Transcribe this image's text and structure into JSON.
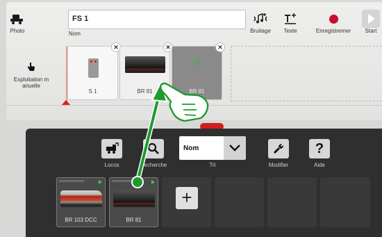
{
  "top": {
    "photo_label": "Photo",
    "name_value": "FS 1",
    "name_label": "Nom",
    "sound_label": "Bruitage",
    "text_label": "Texte",
    "record_label": "Enregistremer",
    "start_label": "Start",
    "exploit_label": "Exploitation m anuelle"
  },
  "steps": [
    {
      "label": "S 1"
    },
    {
      "label": "BR 81"
    },
    {
      "label": "BR 81",
      "value": "0"
    }
  ],
  "library": {
    "locos_label": "Locos",
    "search_label": "Recherche",
    "sort_value": "Nom",
    "sort_label": "Tri",
    "modify_label": "Modifier",
    "help_label": "Aide",
    "help_glyph": "?",
    "add_glyph": "+",
    "locos": [
      {
        "name": "BR 103 DCC"
      },
      {
        "name": "BR 81"
      }
    ]
  },
  "colors": {
    "accent_red": "#c8102e",
    "drag_green": "#1e9a2f",
    "dark_panel": "#2f2f2f"
  }
}
